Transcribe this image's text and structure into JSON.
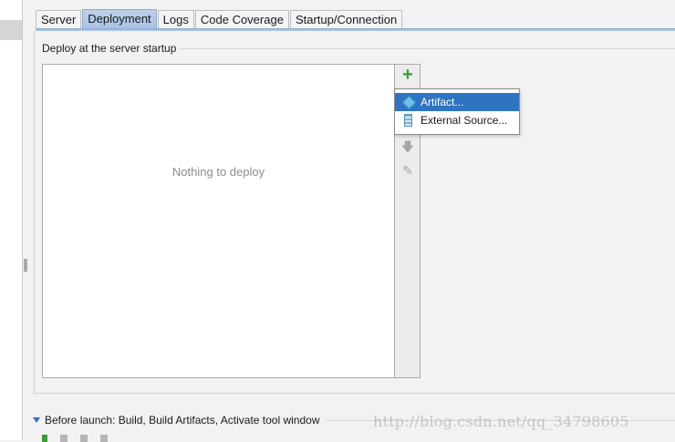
{
  "tabs": [
    {
      "label": "Server",
      "active": false
    },
    {
      "label": "Deployment",
      "active": true
    },
    {
      "label": "Logs",
      "active": false
    },
    {
      "label": "Code Coverage",
      "active": false
    },
    {
      "label": "Startup/Connection",
      "active": false
    }
  ],
  "deploy_group": {
    "title": "Deploy at the server startup",
    "empty_text": "Nothing to deploy"
  },
  "toolbar": {
    "add_icon": "plus-icon",
    "move_down_icon": "arrow-down-icon",
    "edit_icon": "pencil-icon",
    "add_color": "#3a9b3a"
  },
  "popup_menu": {
    "items": [
      {
        "label": "Artifact...",
        "icon": "artifact-icon",
        "selected": true
      },
      {
        "label": "External Source...",
        "icon": "external-source-icon",
        "selected": false
      }
    ],
    "selection_color": "#2f74c1"
  },
  "before_launch": {
    "label": "Before launch: Build, Build Artifacts, Activate tool window"
  },
  "watermark": "http://blog.csdn.net/qq_34798605"
}
